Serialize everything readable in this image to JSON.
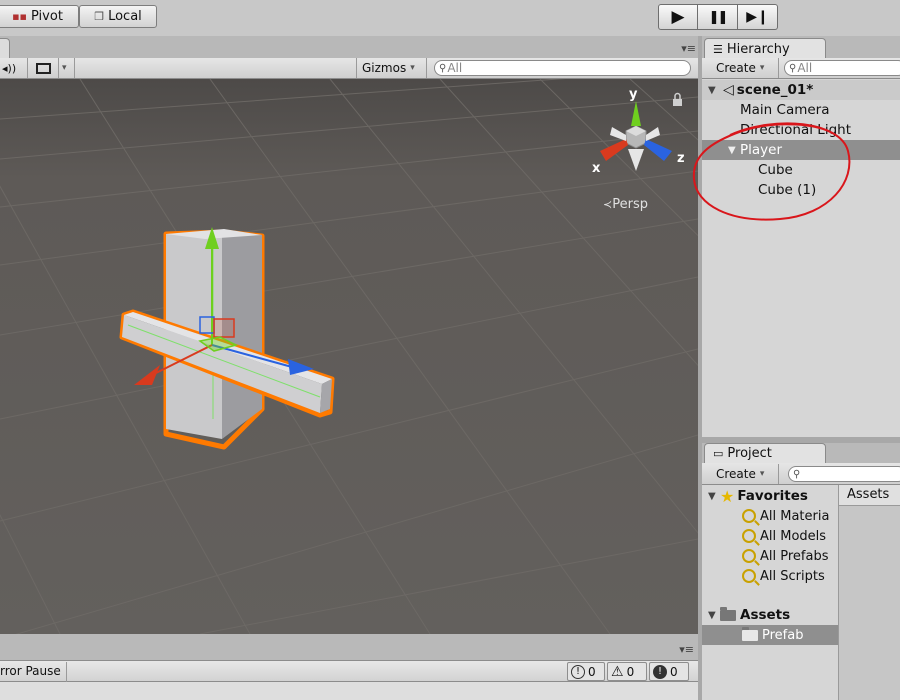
{
  "toolbar": {
    "pivot_label": "Pivot",
    "local_label": "Local",
    "play_icon": "▶",
    "pause_icon": "❚❚",
    "step_icon": "▶❙"
  },
  "scene": {
    "audio_icon": "◂))",
    "gizmos_label": "Gizmos",
    "dropdown_arrow": "▾",
    "search_placeholder": "All",
    "persp_label": "Persp",
    "axis_x": "x",
    "axis_y": "y",
    "axis_z": "z"
  },
  "console": {
    "error_pause_label": "rror Pause",
    "info_count": "0",
    "warn_count": "0",
    "error_count": "0"
  },
  "hierarchy": {
    "tab_label": "Hierarchy",
    "create_label": "Create",
    "search_placeholder": "All",
    "scene_name": "scene_01*",
    "items": [
      {
        "label": "Main Camera"
      },
      {
        "label": "Directional Light"
      },
      {
        "label": "Player"
      },
      {
        "label": "Cube"
      },
      {
        "label": "Cube (1)"
      }
    ]
  },
  "project": {
    "tab_label": "Project",
    "create_label": "Create",
    "favorites_label": "Favorites",
    "favorites": [
      {
        "label": "All Materia"
      },
      {
        "label": "All Models"
      },
      {
        "label": "All Prefabs"
      },
      {
        "label": "All Scripts"
      }
    ],
    "assets_label": "Assets",
    "folders": [
      {
        "label": "Prefab"
      }
    ],
    "right_header": "Assets"
  },
  "colors": {
    "viewport_bg": "#5f5b58",
    "selection_outline": "#ff7a00",
    "annotation_red": "#d9161b",
    "axis_x": "#d93a1e",
    "axis_y": "#6fcf1f",
    "axis_z": "#2a63e0"
  }
}
